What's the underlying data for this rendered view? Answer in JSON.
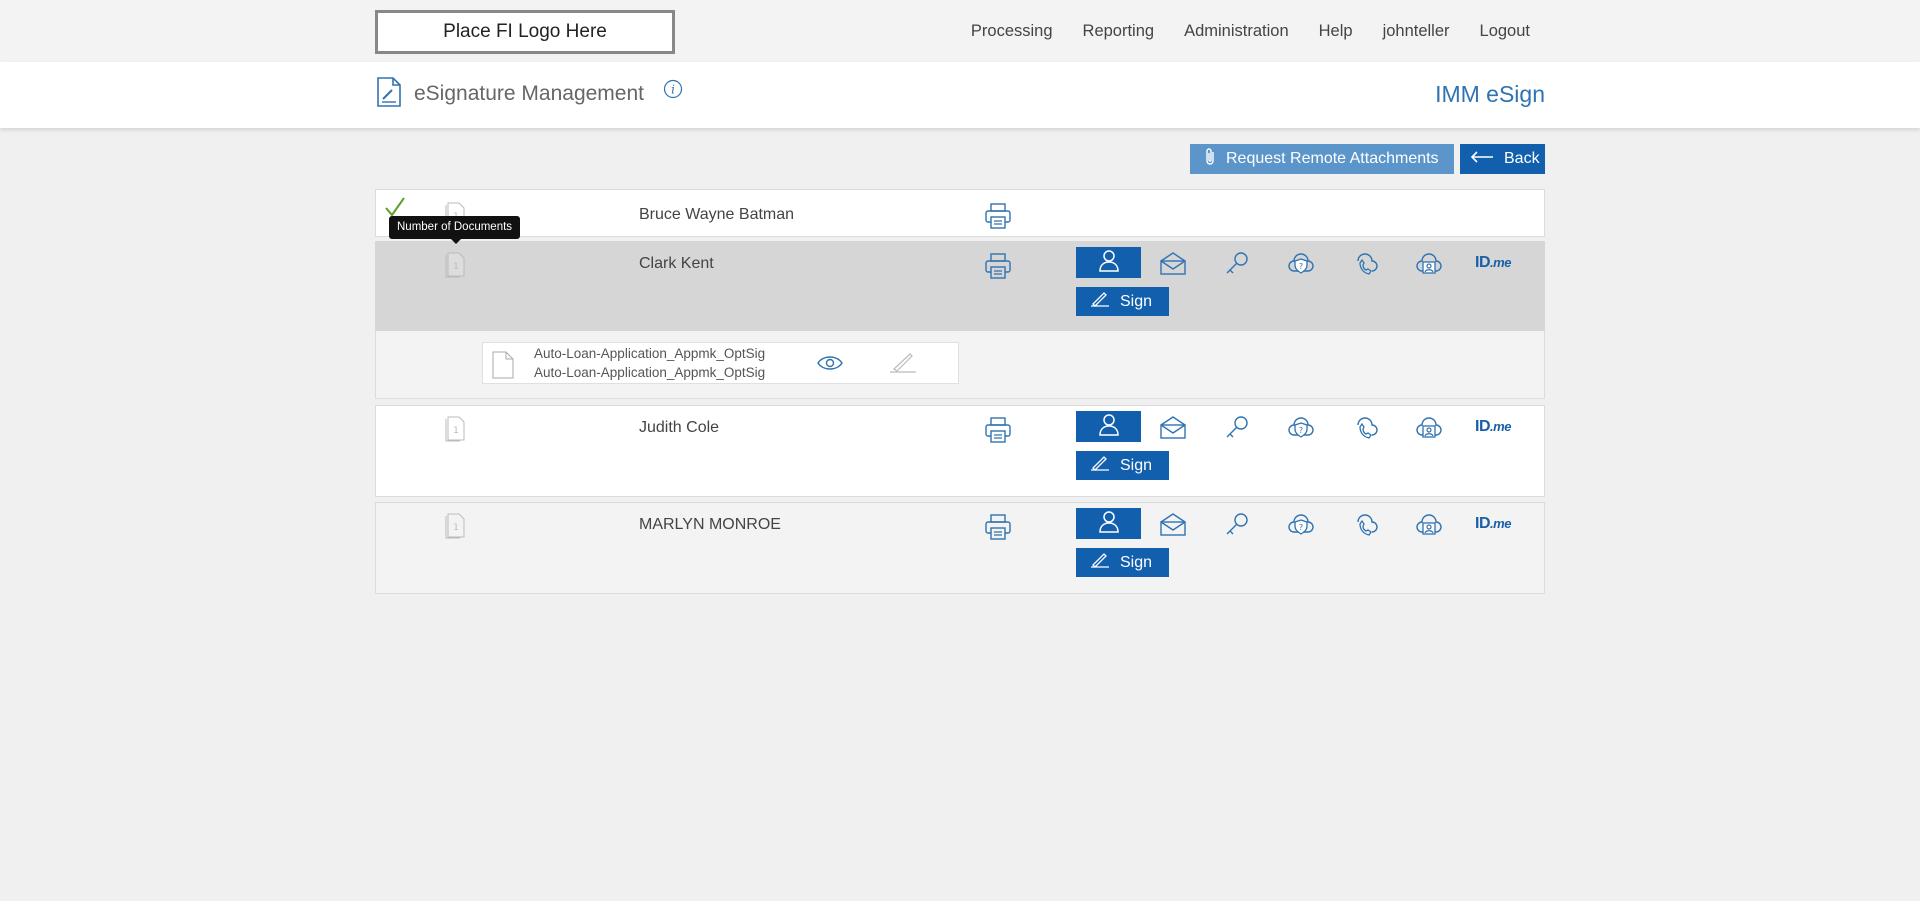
{
  "header": {
    "logo_text": "Place FI Logo Here",
    "nav": [
      "Processing",
      "Reporting",
      "Administration",
      "Help",
      "johnteller",
      "Logout"
    ]
  },
  "subheader": {
    "title": "eSignature Management",
    "brand": "IMM eSign"
  },
  "actions": {
    "attach_label": "Request Remote Attachments",
    "back_label": "Back"
  },
  "tooltip": "Number of Documents",
  "signers": [
    {
      "name": "Bruce Wayne Batman",
      "signed": true
    },
    {
      "name": "Clark Kent",
      "sign_label": "Sign"
    },
    {
      "name": "Judith Cole",
      "sign_label": "Sign"
    },
    {
      "name": "MARLYN MONROE",
      "sign_label": "Sign"
    }
  ],
  "document": {
    "line1": "Auto-Loan-Application_Appmk_OptSig",
    "line2": "Auto-Loan-Application_Appmk_OptSig"
  },
  "auth_methods": [
    "in-person-icon",
    "email-icon",
    "key-icon",
    "security-question-icon",
    "phone-icon",
    "cloud-id-icon",
    "idme-logo"
  ],
  "idme_text": {
    "id": "ID",
    "me": ".me"
  },
  "colors": {
    "primary": "#1260ad",
    "attach": "#5b95c9",
    "brand": "#2f73b0",
    "check": "#5aa02c"
  }
}
